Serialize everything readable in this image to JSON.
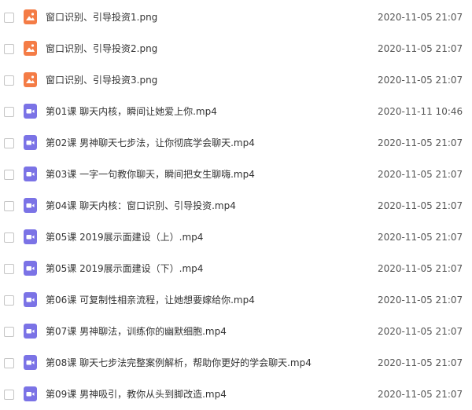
{
  "colors": {
    "image_icon": "#f47c46",
    "video_icon": "#7b73e6",
    "text": "#333333",
    "date_text": "#555555",
    "checkbox_border": "#c4c4c4"
  },
  "files": [
    {
      "name": "窗口识别、引导投资1.png",
      "date": "2020-11-05 21:07",
      "icon": "image-file-icon"
    },
    {
      "name": "窗口识别、引导投资2.png",
      "date": "2020-11-05 21:07",
      "icon": "image-file-icon"
    },
    {
      "name": "窗口识别、引导投资3.png",
      "date": "2020-11-05 21:07",
      "icon": "image-file-icon"
    },
    {
      "name": "第01课 聊天内核，瞬间让她爱上你.mp4",
      "date": "2020-11-11 10:46",
      "icon": "video-file-icon"
    },
    {
      "name": "第02课 男神聊天七步法，让你彻底学会聊天.mp4",
      "date": "2020-11-05 21:07",
      "icon": "video-file-icon"
    },
    {
      "name": "第03课 一字一句教你聊天，瞬间把女生聊嗨.mp4",
      "date": "2020-11-05 21:07",
      "icon": "video-file-icon"
    },
    {
      "name": "第04课 聊天内核：窗口识别、引导投资.mp4",
      "date": "2020-11-05 21:07",
      "icon": "video-file-icon"
    },
    {
      "name": "第05课 2019展示面建设（上）.mp4",
      "date": "2020-11-05 21:07",
      "icon": "video-file-icon"
    },
    {
      "name": "第05课 2019展示面建设（下）.mp4",
      "date": "2020-11-05 21:07",
      "icon": "video-file-icon"
    },
    {
      "name": "第06课 可复制性相亲流程，让她想要嫁给你.mp4",
      "date": "2020-11-05 21:07",
      "icon": "video-file-icon"
    },
    {
      "name": "第07课 男神聊法，训练你的幽默细胞.mp4",
      "date": "2020-11-05 21:07",
      "icon": "video-file-icon"
    },
    {
      "name": "第08课 聊天七步法完整案例解析，帮助你更好的学会聊天.mp4",
      "date": "2020-11-05 21:07",
      "icon": "video-file-icon"
    },
    {
      "name": "第09课 男神吸引，教你从头到脚改造.mp4",
      "date": "2020-11-05 21:07",
      "icon": "video-file-icon"
    }
  ]
}
